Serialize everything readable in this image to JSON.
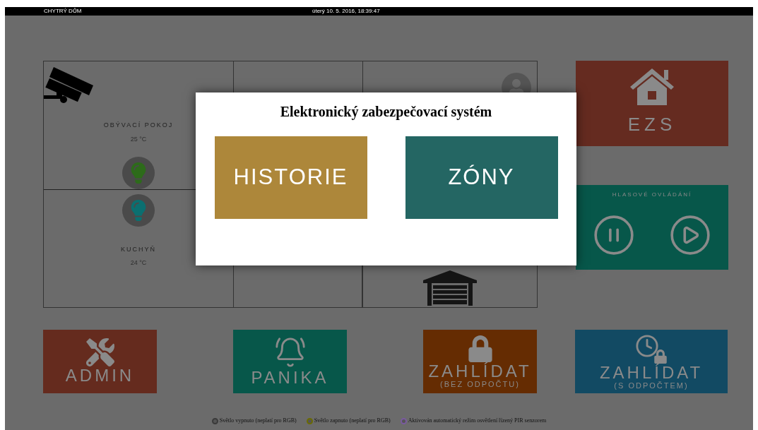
{
  "top_bar": {
    "title": "CHYTRÝ DŮM",
    "datetime": "úterý 10. 5. 2016, 18:39:47"
  },
  "rooms": [
    {
      "name": "OBÝVACÍ POKOJ",
      "temperature": "25 °C",
      "color": "#2d6b1a"
    },
    {
      "name": "KUCHYŇ",
      "temperature": "24 °C",
      "color": "#0b6f70"
    }
  ],
  "side_tiles": [
    {
      "kind": "ezs",
      "label": "EZS",
      "color": "#652b20"
    },
    {
      "kind": "voice",
      "label": "HLASOVÉ OVLÁDÁNÍ",
      "color": "#07574a"
    }
  ],
  "bottom_tiles": [
    {
      "kind": "tools",
      "label": "ADMIN",
      "color": "#652b1e"
    },
    {
      "kind": "bell",
      "label": "PANIKA",
      "color": "#07574a"
    },
    {
      "kind": "lock",
      "label": "ZAHLÍDAT",
      "sublabel": "(BEZ ODPOČTU)",
      "color": "#652c02"
    },
    {
      "kind": "clocklock",
      "label": "ZAHLÍDAT",
      "sublabel": "(S ODPOČTEM)",
      "color": "#124a63"
    }
  ],
  "legend": [
    {
      "text": "Světlo vypnuto (neplatí pro RGB)",
      "color": "#3a3a3a"
    },
    {
      "text": "Světlo zapnuto (neplatí pro RGB)",
      "color": "#6b6b00"
    },
    {
      "text": "Aktivován automatický režim osvětlení řízený PIR senzorem",
      "color": "#7a5aa0"
    }
  ],
  "modal": {
    "title": "Elektronický zabezpečovací systém",
    "buttons": [
      {
        "label": "HISTORIE",
        "color": "#ad873a"
      },
      {
        "label": "ZÓNY",
        "color": "#246663"
      }
    ]
  }
}
